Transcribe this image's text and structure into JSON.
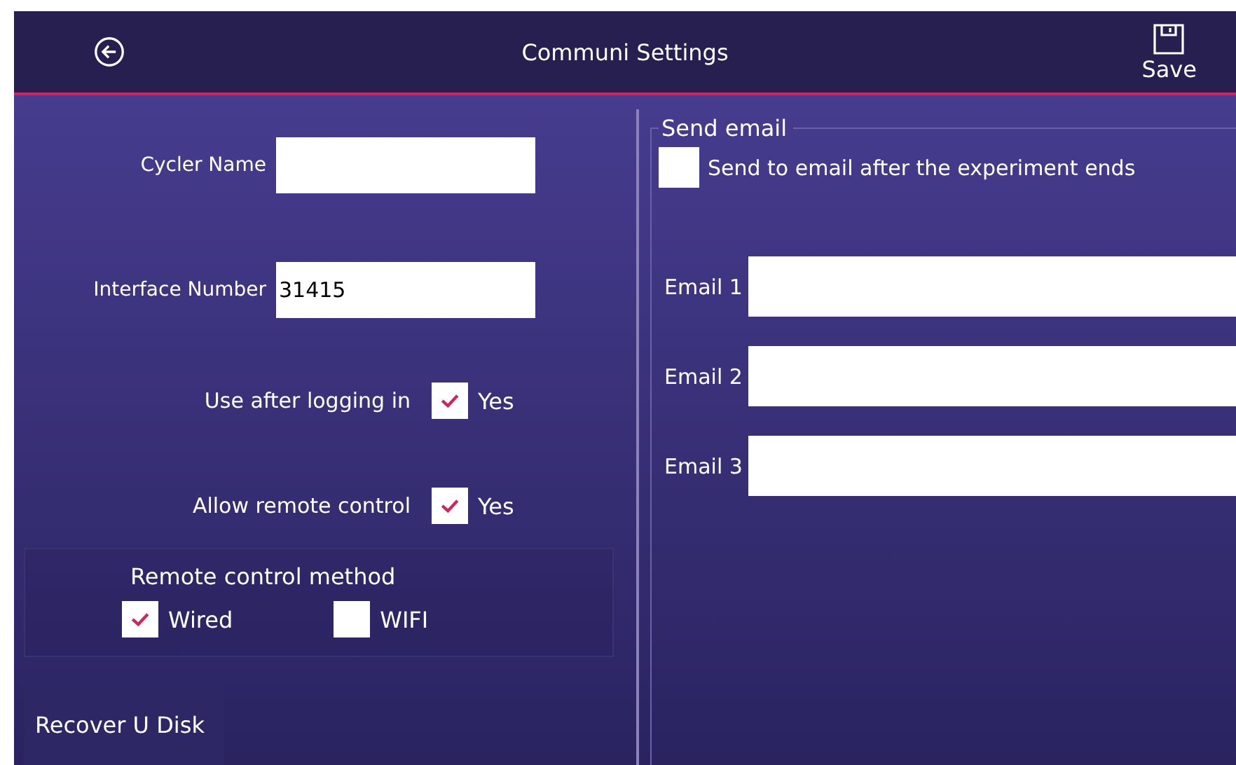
{
  "header": {
    "title": "Communi Settings",
    "save_label": "Save"
  },
  "fields": [
    {
      "label": "Cycler Name"
    },
    {
      "label": "Interface Number",
      "value": "31415"
    }
  ],
  "options": [
    {
      "label": "Use after logging in",
      "checked": true,
      "option_label": "Yes"
    },
    {
      "label": "Allow remote control",
      "checked": true,
      "option_label": "Yes"
    }
  ],
  "remote_control_method": {
    "title": "Remote control method",
    "choices": [
      {
        "label": "Wired",
        "checked": true
      },
      {
        "label": "WIFI",
        "checked": false
      }
    ]
  },
  "recover_button": "Recover U Disk",
  "send_email": {
    "title": "Send email",
    "checkbox": {
      "label": "Send to email after the experiment ends",
      "checked": false
    },
    "emails": [
      {
        "label": "Email 1"
      },
      {
        "label": "Email 2"
      },
      {
        "label": "Email 3"
      }
    ]
  }
}
